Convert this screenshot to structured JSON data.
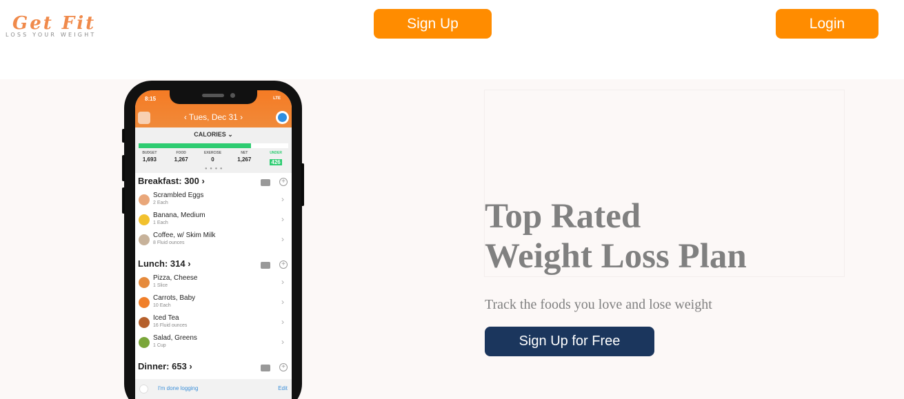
{
  "brand": {
    "name": "Get Fit",
    "tagline": "LOSS YOUR WEIGHT",
    "accent": "#ff8c00",
    "navy": "#1b365d"
  },
  "nav": {
    "signup_label": "Sign Up",
    "login_label": "Login"
  },
  "hero": {
    "headline_line1": "Top Rated",
    "headline_line2": "Weight Loss Plan",
    "subhead": "Track the foods you love and lose weight",
    "cta_label": "Sign Up for Free"
  },
  "phone": {
    "status_time": "8:15",
    "status_network": "LTE",
    "date": "‹  Tues, Dec 31  ›",
    "calories_title": "CALORIES ⌄",
    "progress_fraction": 0.75,
    "stats": [
      {
        "label": "BUDGET",
        "value": "1,693"
      },
      {
        "label": "FOOD",
        "value": "1,267"
      },
      {
        "label": "EXERCISE",
        "value": "0"
      },
      {
        "label": "NET",
        "value": "1,267"
      },
      {
        "label": "UNDER",
        "value": "426"
      }
    ],
    "sections": [
      {
        "title": "Breakfast: 300 ›",
        "items": [
          {
            "name": "Scrambled Eggs",
            "qty": "2 Each",
            "icon": "egg-icon",
            "color": "#e9a77a"
          },
          {
            "name": "Banana, Medium",
            "qty": "1 Each",
            "icon": "banana-icon",
            "color": "#f2c12e"
          },
          {
            "name": "Coffee, w/ Skim Milk",
            "qty": "8 Fluid ounces",
            "icon": "coffee-icon",
            "color": "#c7b29a"
          }
        ]
      },
      {
        "title": "Lunch: 314 ›",
        "items": [
          {
            "name": "Pizza, Cheese",
            "qty": "1 Slice",
            "icon": "pizza-icon",
            "color": "#e58a3c"
          },
          {
            "name": "Carrots, Baby",
            "qty": "10 Each",
            "icon": "carrot-icon",
            "color": "#f07f2a"
          },
          {
            "name": "Iced Tea",
            "qty": "16 Fluid ounces",
            "icon": "iced-tea-icon",
            "color": "#b5602c"
          },
          {
            "name": "Salad, Greens",
            "qty": "1 Cup",
            "icon": "salad-icon",
            "color": "#7aa63a"
          }
        ]
      },
      {
        "title": "Dinner: 653 ›",
        "items": []
      }
    ],
    "done_text": "I'm done logging",
    "edit_text": "Edit"
  }
}
